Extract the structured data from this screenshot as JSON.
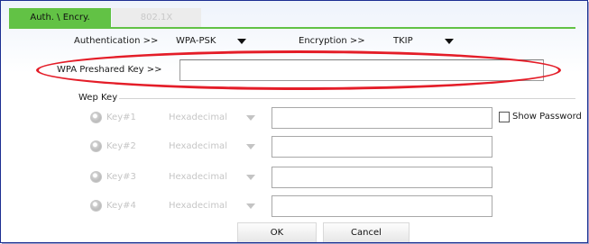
{
  "tabs": {
    "active": "Auth. \\ Encry.",
    "inactive": "802.1X"
  },
  "security": {
    "auth_label": "Authentication >>",
    "auth_value": "WPA-PSK",
    "enc_label": "Encryption >>",
    "enc_value": "TKIP",
    "psk_label": "WPA Preshared Key >>",
    "psk_value": ""
  },
  "wep": {
    "section_label": "Wep Key",
    "keys": [
      {
        "label": "Key#1",
        "format": "Hexadecimal",
        "value": ""
      },
      {
        "label": "Key#2",
        "format": "Hexadecimal",
        "value": ""
      },
      {
        "label": "Key#3",
        "format": "Hexadecimal",
        "value": ""
      },
      {
        "label": "Key#4",
        "format": "Hexadecimal",
        "value": ""
      }
    ],
    "show_password": "Show Password"
  },
  "buttons": {
    "ok": "OK",
    "cancel": "Cancel"
  },
  "colors": {
    "tab_active": "#62c245",
    "highlight_oval": "#e41d28",
    "frame_border": "#1c2f92"
  }
}
